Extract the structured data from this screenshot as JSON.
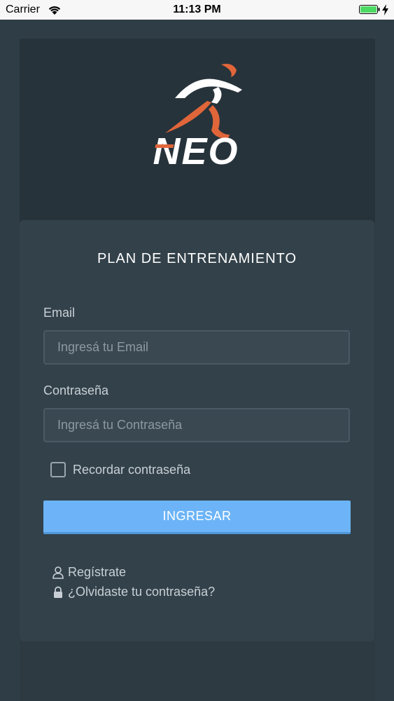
{
  "status_bar": {
    "carrier": "Carrier",
    "time": "11:13 PM",
    "battery_color": "#4cd964"
  },
  "logo": {
    "text": "NEO",
    "icon": "runner-logo-icon",
    "accent_color": "#e0663a"
  },
  "card": {
    "title": "PLAN DE ENTRENAMIENTO"
  },
  "form": {
    "email_label": "Email",
    "email_placeholder": "Ingresá tu Email",
    "email_value": "",
    "password_label": "Contraseña",
    "password_placeholder": "Ingresá tu Contraseña",
    "password_value": "",
    "remember_label": "Recordar contraseña",
    "remember_checked": false,
    "submit_label": "INGRESAR",
    "submit_color": "#6cb4f7"
  },
  "links": {
    "register_label": "Regístrate",
    "register_icon": "user-icon",
    "forgot_label": "¿Olvidaste tu contraseña?",
    "forgot_icon": "lock-icon"
  }
}
